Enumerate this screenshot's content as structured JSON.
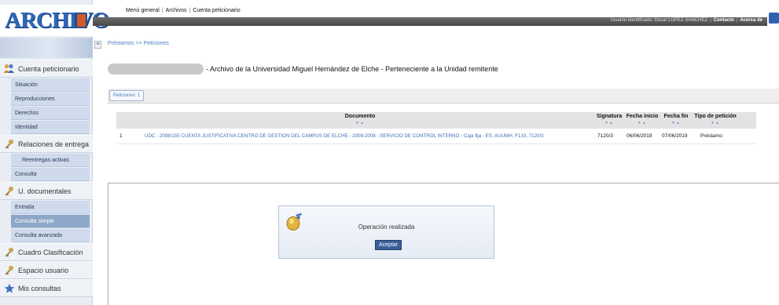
{
  "logo": {
    "text": "ARCHIVO"
  },
  "top_menu": [
    "Menú general",
    "Archivos",
    "Cuenta peticionario"
  ],
  "top_bar": {
    "user_label": "Usuario identificado: Oscar LÓPEZ SÁNCHEZ",
    "contact": "Contacto",
    "about": "Acerca de"
  },
  "sidebar": {
    "sections": [
      {
        "label": "Cuenta peticionario",
        "icon": "people-icon",
        "items": [
          "Situación",
          "Reproducciones",
          "Derechos",
          "Identidad"
        ]
      },
      {
        "label": "Relaciones de entrega",
        "icon": "key-icon",
        "items": [
          "Reentregas activas",
          "Consulta"
        ]
      },
      {
        "label": "U. documentales",
        "icon": "key-icon",
        "items": [
          "Entrada",
          "Consulta simple",
          "Consulta avanzada"
        ],
        "active_item": "Consulta simple"
      },
      {
        "label": "Cuadro Clasificación",
        "icon": "key-icon",
        "items": []
      },
      {
        "label": "Espacio usuario",
        "icon": "key-icon",
        "items": []
      },
      {
        "label": "Mis consultas",
        "icon": "star-icon",
        "items": []
      }
    ]
  },
  "breadcrumb": "Préstamos >> Peticiones",
  "archive_line": "- Archivo de la Universidad Miguel Hernández de Elche - Perteneciente a la Unidad remitente",
  "tab": "Peticiones: 1",
  "table": {
    "headers": [
      "Documento",
      "Signatura",
      "Fecha inicio",
      "Fecha fin",
      "Tipo de petición"
    ],
    "sort_glyph": "▼▲",
    "rows": [
      {
        "index": "1",
        "documento": "UDC - 2008/155 CUENTA JUSTIFICATIVA CENTRO DE GESTION DEL CAMPUS DE ELCHE - 2008-2008 - SERVICIO DE CONTROL INTERNO - Caja fija - ES. AUUMH, F133, 7120/3",
        "signatura": "7120/3",
        "fecha_inicio": "06/06/2019",
        "fecha_fin": "07/06/2019",
        "tipo": "Préstamo"
      }
    ]
  },
  "dialog": {
    "message": "Operación realizada",
    "ok_label": "Aceptar"
  },
  "colors": {
    "link": "#3f6fb6",
    "topbar": "#555555",
    "button": "#3a5f98",
    "sidebar_active": "#8ea7c8"
  }
}
